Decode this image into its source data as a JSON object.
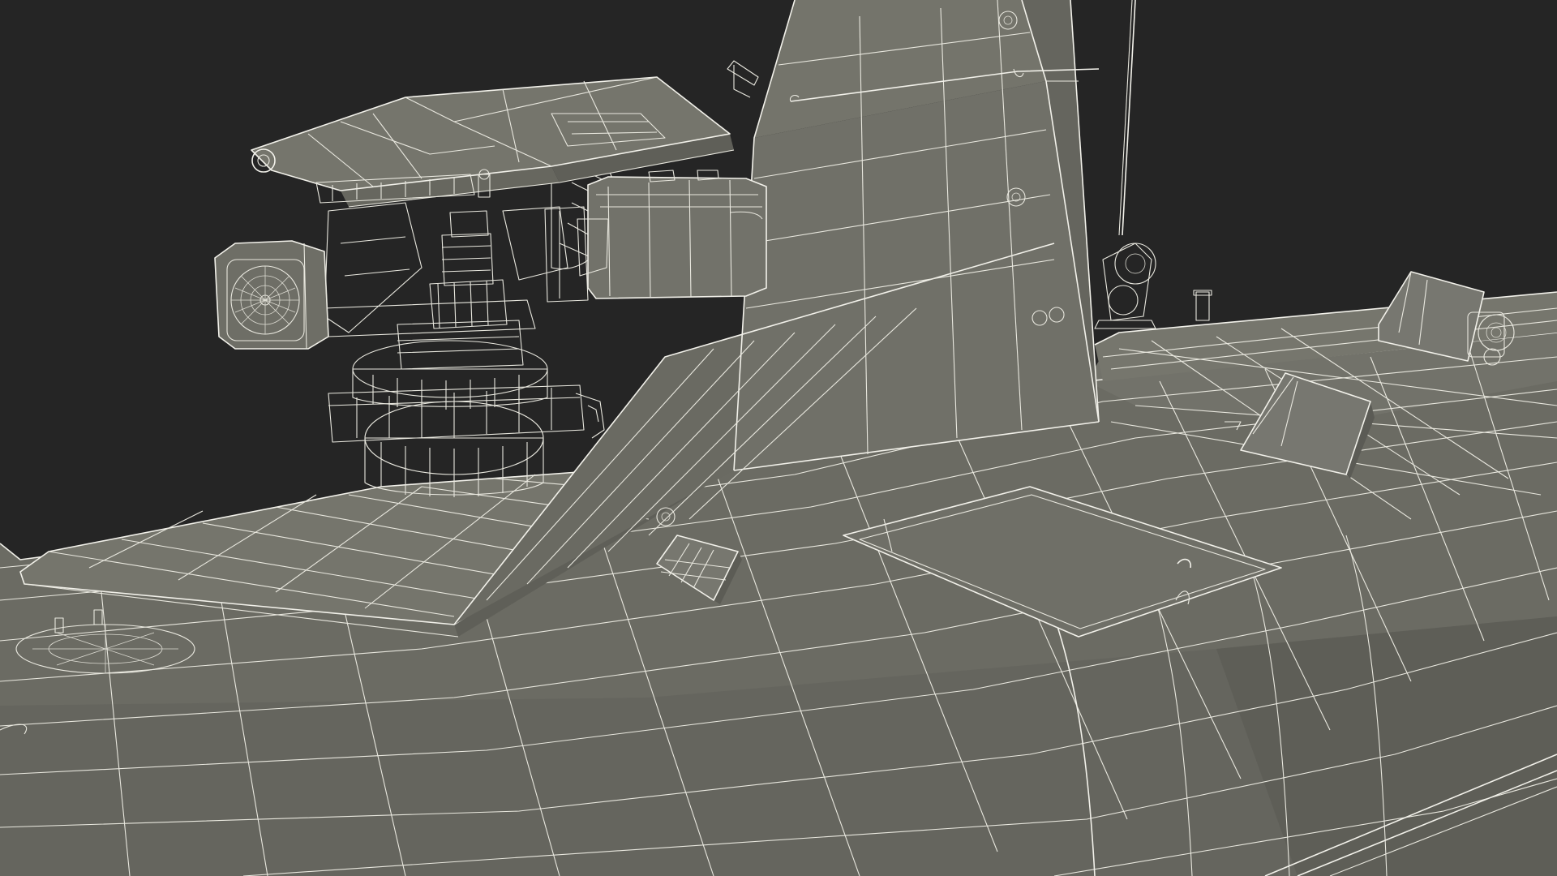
{
  "scene": {
    "background_color": "#252525",
    "surface_color": "#6e6e66",
    "surface_shadow_color": "#5c5c55",
    "surface_light_color": "#7c7c73",
    "wire_color": "#e9e8df"
  },
  "objects": [
    {
      "name": "boat-hull",
      "icon": "hull"
    },
    {
      "name": "deck-ramp",
      "icon": "ramp"
    },
    {
      "name": "tower-mast",
      "icon": "mast"
    },
    {
      "name": "weapon-turret",
      "icon": "turret"
    },
    {
      "name": "sensor-camera-housing",
      "icon": "camera"
    },
    {
      "name": "ammo-box",
      "icon": "box"
    },
    {
      "name": "deck-hatch",
      "icon": "hatch"
    },
    {
      "name": "rear-vent",
      "icon": "vent"
    },
    {
      "name": "stern-sensor",
      "icon": "sensor"
    },
    {
      "name": "antenna-whip",
      "icon": "antenna"
    },
    {
      "name": "antenna-mount",
      "icon": "mount"
    }
  ]
}
